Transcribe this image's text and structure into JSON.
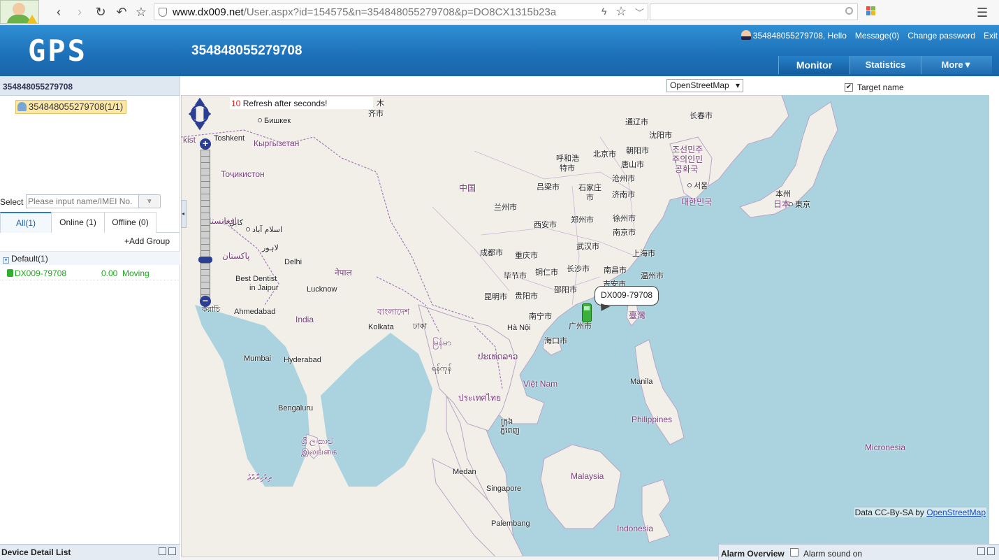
{
  "browser": {
    "url_host": "www.dx009.net",
    "url_path": "/User.aspx?id=154575&n=354848055279708&p=DO8CX1315b23a"
  },
  "header": {
    "logo": "GPS",
    "title": "354848055279708",
    "user_greeting": "354848055279708, Hello",
    "message": "Message(0)",
    "change_password": "Change password",
    "exit": "Exit",
    "tabs": [
      "Monitor",
      "Statistics",
      "More▼"
    ]
  },
  "sidebar": {
    "tree_header": "354848055279708",
    "tree_node": "354848055279708(1/1)",
    "select_label": "Select :",
    "select_placeholder": "Please input name/IMEI No.",
    "status_tabs": [
      "All(1)",
      "Online (1)",
      "Offline (0)"
    ],
    "add_group": "+Add Group",
    "group": "Default(1)",
    "device": {
      "name": "DX009-79708",
      "speed": "0.00",
      "state": "Moving"
    },
    "detail_footer": "Device Detail List"
  },
  "map": {
    "provider": "OpenStreetMap",
    "target_name_label": "Target name",
    "target_name_checked": true,
    "refresh_count": "10",
    "refresh_text": "Refresh after seconds!",
    "vehicle_label": "DX009-79708",
    "attribution_prefix": "Data CC-By-SA by",
    "attribution_link": "OpenStreetMap",
    "places": [
      {
        "t": "木",
        "k": "city"
      },
      {
        "t": "齐市",
        "k": "city"
      },
      {
        "t": "Бишкек",
        "k": "dot"
      },
      {
        "t": "Toshkent",
        "k": "city"
      },
      {
        "t": "Кыргызстан",
        "k": "country"
      },
      {
        "t": "Тоҷикистон",
        "k": "country"
      },
      {
        "t": "kist",
        "k": "country"
      },
      {
        "t": "كابل",
        "k": "dot"
      },
      {
        "t": "اسلام آباد",
        "k": "dot"
      },
      {
        "t": "افغانستا",
        "k": "country"
      },
      {
        "t": "لاہور",
        "k": "city"
      },
      {
        "t": "پاکستان",
        "k": "country"
      },
      {
        "t": "Delhi",
        "k": "city"
      },
      {
        "t": "नेपाल",
        "k": "country"
      },
      {
        "t": "Best Dentist",
        "k": "city"
      },
      {
        "t": "in Jaipur",
        "k": "city"
      },
      {
        "t": "Lucknow",
        "k": "city"
      },
      {
        "t": "করাচি",
        "k": "city"
      },
      {
        "t": "Ahmedabad",
        "k": "city"
      },
      {
        "t": "India",
        "k": "country"
      },
      {
        "t": "বাংলাদেশ",
        "k": "country"
      },
      {
        "t": "Kolkata",
        "k": "city"
      },
      {
        "t": "ঢাকা",
        "k": "city"
      },
      {
        "t": "Mumbai",
        "k": "city"
      },
      {
        "t": "Hyderabad",
        "k": "city"
      },
      {
        "t": "Bengaluru",
        "k": "city"
      },
      {
        "t": "ශ්‍රී ලංකාව",
        "k": "country"
      },
      {
        "t": "இலங்கை",
        "k": "country"
      },
      {
        "t": "ދިވެހިރާއްޖެ",
        "k": "country"
      },
      {
        "t": "中国",
        "k": "country"
      },
      {
        "t": "通辽市",
        "k": "city"
      },
      {
        "t": "长春市",
        "k": "city"
      },
      {
        "t": "沈阳市",
        "k": "city"
      },
      {
        "t": "呼和浩",
        "k": "city"
      },
      {
        "t": "特市",
        "k": "city"
      },
      {
        "t": "北京市",
        "k": "city"
      },
      {
        "t": "朝阳市",
        "k": "city"
      },
      {
        "t": "唐山市",
        "k": "city"
      },
      {
        "t": "조선민주",
        "k": "country"
      },
      {
        "t": "주의인민",
        "k": "country"
      },
      {
        "t": "공화국",
        "k": "country"
      },
      {
        "t": "沧州市",
        "k": "city"
      },
      {
        "t": "石家庄",
        "k": "city"
      },
      {
        "t": "市",
        "k": "city"
      },
      {
        "t": "济南市",
        "k": "city"
      },
      {
        "t": "서울",
        "k": "dot"
      },
      {
        "t": "대한민국",
        "k": "country"
      },
      {
        "t": "本州",
        "k": "city"
      },
      {
        "t": "日本",
        "k": "country"
      },
      {
        "t": "東京",
        "k": "dot"
      },
      {
        "t": "吕梁市",
        "k": "city"
      },
      {
        "t": "兰州市",
        "k": "city"
      },
      {
        "t": "郑州市",
        "k": "city"
      },
      {
        "t": "徐州市",
        "k": "city"
      },
      {
        "t": "西安市",
        "k": "city"
      },
      {
        "t": "南京市",
        "k": "city"
      },
      {
        "t": "武汉市",
        "k": "city"
      },
      {
        "t": "成都市",
        "k": "city"
      },
      {
        "t": "重庆市",
        "k": "city"
      },
      {
        "t": "上海市",
        "k": "city"
      },
      {
        "t": "毕节市",
        "k": "city"
      },
      {
        "t": "铜仁市",
        "k": "city"
      },
      {
        "t": "长沙市",
        "k": "city"
      },
      {
        "t": "南昌市",
        "k": "city"
      },
      {
        "t": "温州市",
        "k": "city"
      },
      {
        "t": "吉安市",
        "k": "city"
      },
      {
        "t": "昆明市",
        "k": "city"
      },
      {
        "t": "贵阳市",
        "k": "city"
      },
      {
        "t": "邵阳市",
        "k": "city"
      },
      {
        "t": "南宁市",
        "k": "city"
      },
      {
        "t": "广州市",
        "k": "city"
      },
      {
        "t": "臺灣",
        "k": "country"
      },
      {
        "t": "Hà Nội",
        "k": "city"
      },
      {
        "t": "海口市",
        "k": "city"
      },
      {
        "t": "မြန်မာ",
        "k": "country"
      },
      {
        "t": "ປະເທດລາວ",
        "k": "country"
      },
      {
        "t": "ရန်ကုန်",
        "k": "city"
      },
      {
        "t": "Việt Nam",
        "k": "country"
      },
      {
        "t": "ประเทศไทย",
        "k": "country"
      },
      {
        "t": "ក្រុង",
        "k": "city"
      },
      {
        "t": "ភ្នំពេញ",
        "k": "city"
      },
      {
        "t": "Manila",
        "k": "city"
      },
      {
        "t": "Philippines",
        "k": "country"
      },
      {
        "t": "Micronesia",
        "k": "country"
      },
      {
        "t": "Medan",
        "k": "city"
      },
      {
        "t": "Malaysia",
        "k": "country"
      },
      {
        "t": "Singapore",
        "k": "city"
      },
      {
        "t": "Palembang",
        "k": "city"
      },
      {
        "t": "Indonesia",
        "k": "country"
      }
    ]
  },
  "alarm": {
    "title": "Alarm Overview",
    "sound_label": "Alarm sound on"
  }
}
